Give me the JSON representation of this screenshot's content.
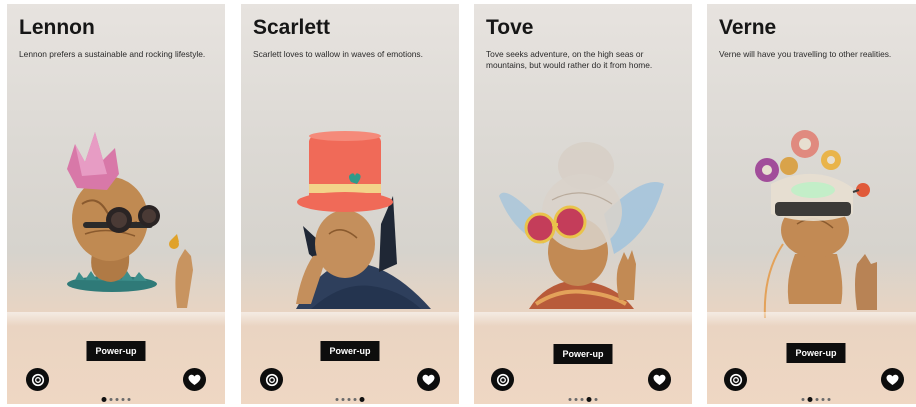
{
  "screens": [
    {
      "name": "Lennon",
      "description": "Lennon prefers a sustainable and rocking lifestyle.",
      "power_label": "Power-up",
      "active_dot": 1,
      "dot_count": 5
    },
    {
      "name": "Scarlett",
      "description": "Scarlett loves to wallow in waves of emotions.",
      "power_label": "Power-up",
      "active_dot": 5,
      "dot_count": 5
    },
    {
      "name": "Tove",
      "description": "Tove seeks adventure, on the high seas or mountains, but would rather do it from home.",
      "power_label": "Power-up",
      "active_dot": 4,
      "dot_count": 5
    },
    {
      "name": "Verne",
      "description": "Verne will have you travelling to other realities.",
      "power_label": "Power-up",
      "active_dot": 2,
      "dot_count": 5
    }
  ],
  "icons": {
    "left_button": "settings-ring-icon",
    "right_button": "heart-icon"
  },
  "colors": {
    "button_bg": "#0d0d0d",
    "title_text": "#161616"
  }
}
